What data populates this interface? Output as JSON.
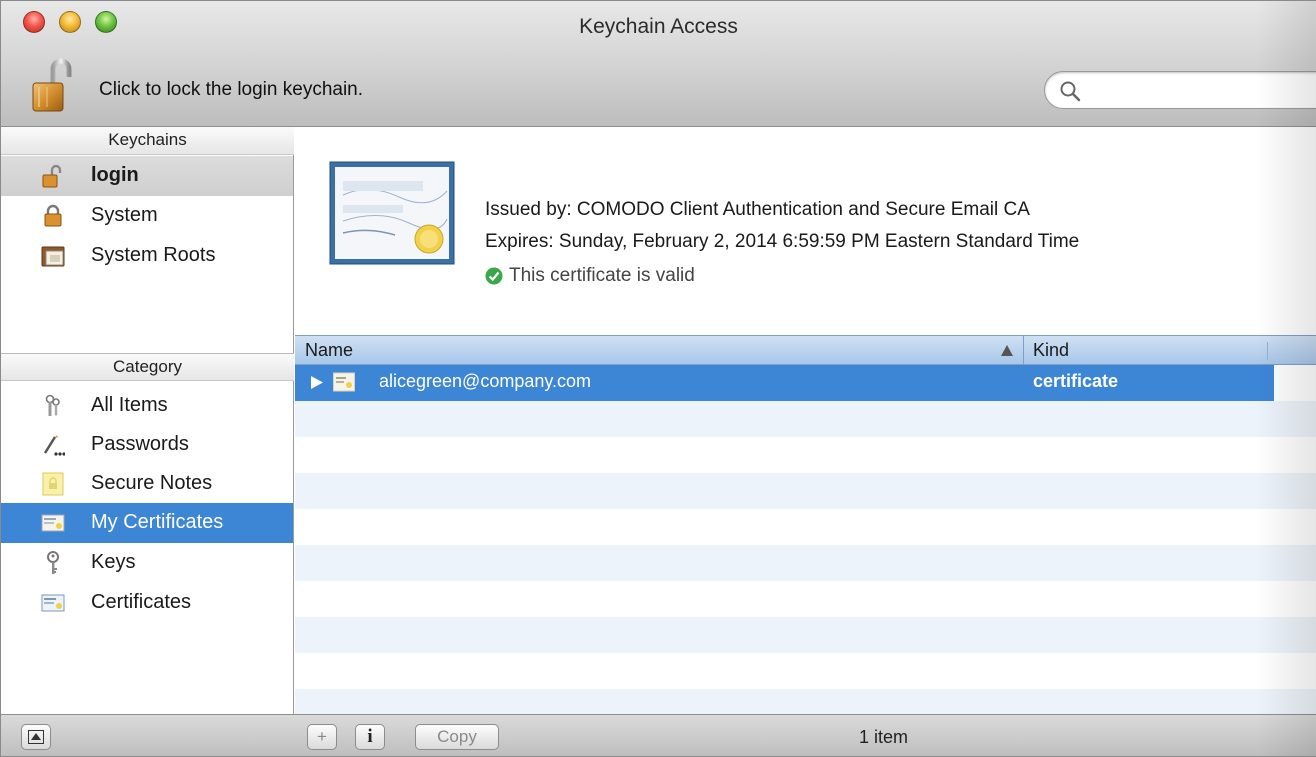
{
  "window": {
    "title": "Keychain Access"
  },
  "toolbar": {
    "lock_text": "Click to lock the login keychain.",
    "search_placeholder": "",
    "search_value": ""
  },
  "sidebar": {
    "keychains_header": "Keychains",
    "keychains": [
      {
        "label": "login",
        "icon": "lock-open-icon",
        "selected": true
      },
      {
        "label": "System",
        "icon": "lock-icon",
        "selected": false
      },
      {
        "label": "System Roots",
        "icon": "folder-icon",
        "selected": false
      }
    ],
    "category_header": "Category",
    "categories": [
      {
        "label": "All Items",
        "icon": "all-items-icon",
        "selected": false
      },
      {
        "label": "Passwords",
        "icon": "passwords-icon",
        "selected": false
      },
      {
        "label": "Secure Notes",
        "icon": "secure-notes-icon",
        "selected": false
      },
      {
        "label": "My Certificates",
        "icon": "my-certificates-icon",
        "selected": true
      },
      {
        "label": "Keys",
        "icon": "key-icon",
        "selected": false
      },
      {
        "label": "Certificates",
        "icon": "certificate-icon",
        "selected": false
      }
    ]
  },
  "info": {
    "issued_by": "Issued by: COMODO Client Authentication and Secure Email CA",
    "expires": "Expires: Sunday, February 2, 2014 6:59:59 PM Eastern Standard Time",
    "status": "This certificate is valid"
  },
  "table": {
    "columns": {
      "name": "Name",
      "kind": "Kind"
    },
    "rows": [
      {
        "name": "alicegreen@company.com",
        "kind": "certificate"
      }
    ]
  },
  "bottombar": {
    "add_label": "+",
    "info_label": "i",
    "copy_label": "Copy",
    "item_count": "1 item"
  },
  "colors": {
    "selection_blue": "#3d86d6",
    "valid_green": "#3aa84a"
  }
}
